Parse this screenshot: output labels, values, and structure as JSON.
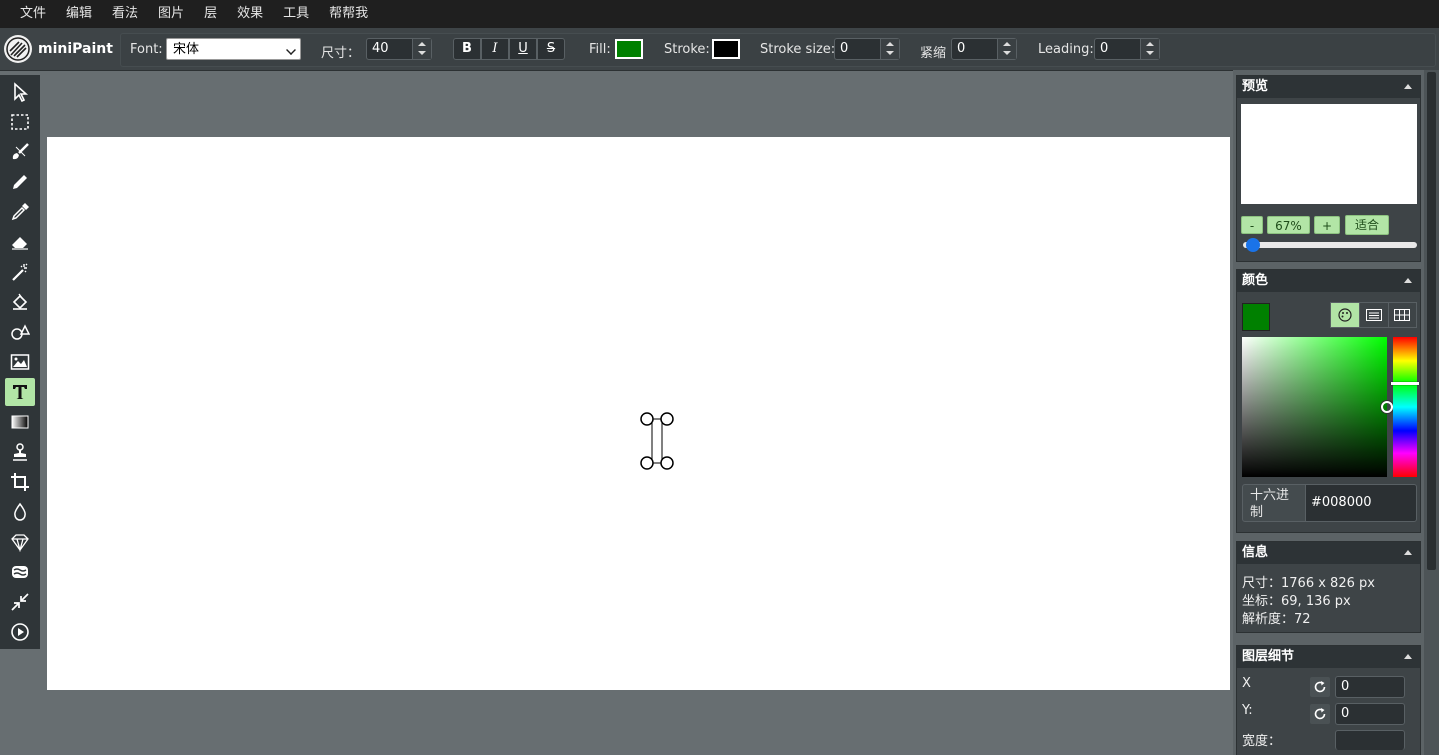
{
  "menu": [
    "文件",
    "编辑",
    "看法",
    "图片",
    "层",
    "效果",
    "工具",
    "帮帮我"
  ],
  "app": {
    "name": "miniPaint"
  },
  "attributes": {
    "font_label": "Font:",
    "font_value": "宋体",
    "size_label": "尺寸：",
    "size_value": "40",
    "bold": "B",
    "italic": "I",
    "underline": "U",
    "strike": "S",
    "fill_label": "Fill:",
    "fill_color": "#008000",
    "stroke_label": "Stroke:",
    "stroke_color": "#000000",
    "stroke_size_label": "Stroke size:",
    "stroke_size_value": "0",
    "kerning_label": "紧缩",
    "kerning_value": "0",
    "leading_label": "Leading:",
    "leading_value": "0"
  },
  "tools": [
    "select-icon",
    "selection-rect-icon",
    "brush-icon",
    "pencil-icon",
    "color-picker-icon",
    "eraser-icon",
    "magic-wand-icon",
    "fill-bucket-icon",
    "shapes-icon",
    "image-icon",
    "text-icon",
    "gradient-icon",
    "clone-stamp-icon",
    "crop-icon",
    "blur-icon",
    "sharpen-icon",
    "bulge-icon",
    "resize-icon",
    "animation-icon"
  ],
  "preview": {
    "title": "预览",
    "minus": "-",
    "zoom": "67%",
    "plus": "+",
    "fit": "适合",
    "zoom_level": 0.03
  },
  "colors": {
    "title": "颜色",
    "current": "#008000",
    "hex_label": "十六进制",
    "hex_value": "#008000"
  },
  "info": {
    "title": "信息",
    "size_label": "尺寸：",
    "size_value": "1766 x 826 px",
    "coords_label": "坐标：",
    "coords_value": "69, 136 px",
    "dpi_label": "解析度：",
    "dpi_value": "72"
  },
  "layer_details": {
    "title": "图层细节",
    "x_label": "X",
    "x_value": "0",
    "y_label": "Y:",
    "y_value": "0",
    "width_label": "宽度："
  }
}
